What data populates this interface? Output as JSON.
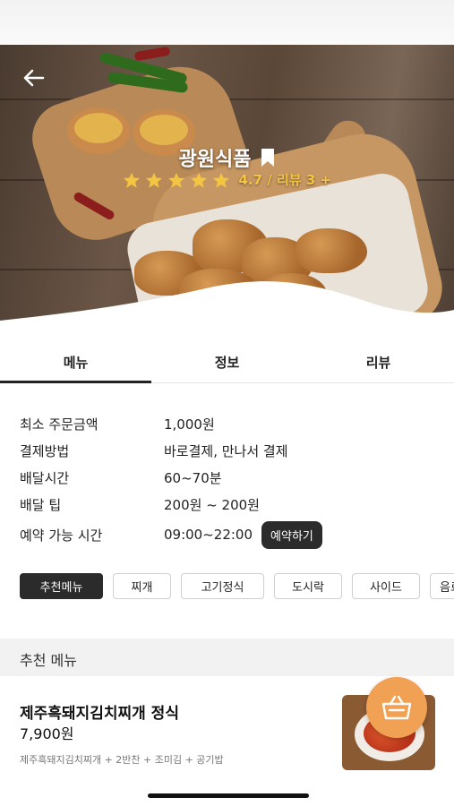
{
  "store": {
    "name": "광원식품",
    "rating_text": "4.7 / 리뷰 3 +",
    "rating_stars": 5
  },
  "tabs": [
    {
      "label": "메뉴",
      "active": true
    },
    {
      "label": "정보",
      "active": false
    },
    {
      "label": "리뷰",
      "active": false
    }
  ],
  "info": {
    "min_order_label": "최소 주문금액",
    "min_order_value": "1,000원",
    "payment_label": "결제방법",
    "payment_value": "바로결제, 만나서 결제",
    "delivery_time_label": "배달시간",
    "delivery_time_value": "60~70분",
    "delivery_tip_label": "배달 팁",
    "delivery_tip_value": "200원 ~ 200원",
    "reservation_label": "예약 가능 시간",
    "reservation_value": "09:00~22:00",
    "reserve_button": "예약하기"
  },
  "categories": [
    "추천메뉴",
    "찌개",
    "고기정식",
    "도시락",
    "사이드",
    "음료"
  ],
  "section_title": "추천 메뉴",
  "menu_items": [
    {
      "name": "제주흑돼지김치찌개 정식",
      "price": "7,900원",
      "description": "제주흑돼지김치찌개 + 2반찬 + 조미김 + 공기밥"
    }
  ],
  "colors": {
    "accent": "#f0a153",
    "star": "#f4c542",
    "dark_button": "#2b2b2b"
  },
  "icons": {
    "back": "arrow-left-icon",
    "bookmark": "bookmark-icon",
    "star": "star-icon",
    "cart": "basket-icon"
  }
}
